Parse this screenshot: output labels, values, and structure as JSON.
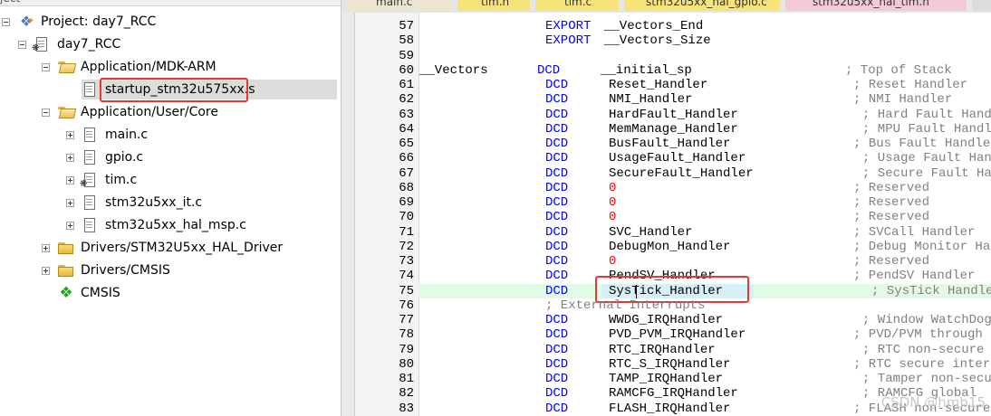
{
  "tree": {
    "top_caption": "ject",
    "project_label": "Project: day7_RCC",
    "target_label": "day7_RCC",
    "groups": [
      {
        "label": "Application/MDK-ARM",
        "children": [
          "startup_stm32u575xx.s"
        ]
      },
      {
        "label": "Application/User/Core",
        "children": [
          "main.c",
          "gpio.c",
          "tim.c",
          "stm32u5xx_it.c",
          "stm32u5xx_hal_msp.c"
        ]
      },
      {
        "label": "Drivers/STM32U5xx_HAL_Driver",
        "children": []
      },
      {
        "label": "Drivers/CMSIS",
        "children": []
      }
    ],
    "cmsis_label": "CMSIS"
  },
  "tabs": [
    "main.c",
    "tim.h",
    "tim.c",
    "stm32u5xx_hal_gpio.c",
    "stm32u5xx_hal_tim.h"
  ],
  "code_lines": [
    {
      "n": "57",
      "kw": "EXPORT",
      "name": "__Vectors_End",
      "cm": ""
    },
    {
      "n": "58",
      "kw": "EXPORT",
      "name": "__Vectors_Size",
      "cm": ""
    },
    {
      "n": "59",
      "kw": "",
      "name": "",
      "cm": ""
    },
    {
      "n": "60",
      "label": "__Vectors",
      "kw": "DCD",
      "name": "__initial_sp",
      "cm": "; Top of Stack"
    },
    {
      "n": "61",
      "kw": "DCD",
      "name": "Reset_Handler",
      "cm": "; Reset Handler"
    },
    {
      "n": "62",
      "kw": "DCD",
      "name": "NMI_Handler",
      "cm": "; NMI Handler"
    },
    {
      "n": "63",
      "kw": "DCD",
      "name": "HardFault_Handler",
      "cm": "; Hard Fault Handler"
    },
    {
      "n": "64",
      "kw": "DCD",
      "name": "MemManage_Handler",
      "cm": "; MPU Fault Handler"
    },
    {
      "n": "65",
      "kw": "DCD",
      "name": "BusFault_Handler",
      "cm": "; Bus Fault Handler"
    },
    {
      "n": "66",
      "kw": "DCD",
      "name": "UsageFault_Handler",
      "cm": "; Usage Fault Handler"
    },
    {
      "n": "67",
      "kw": "DCD",
      "name": "SecureFault_Handler",
      "cm": "; Secure Fault Handler"
    },
    {
      "n": "68",
      "kw": "DCD",
      "num": "0",
      "cm": "; Reserved"
    },
    {
      "n": "69",
      "kw": "DCD",
      "num": "0",
      "cm": "; Reserved"
    },
    {
      "n": "70",
      "kw": "DCD",
      "num": "0",
      "cm": "; Reserved"
    },
    {
      "n": "71",
      "kw": "DCD",
      "name": "SVC_Handler",
      "cm": "; SVCall Handler"
    },
    {
      "n": "72",
      "kw": "DCD",
      "name": "DebugMon_Handler",
      "cm": "; Debug Monitor Handler"
    },
    {
      "n": "73",
      "kw": "DCD",
      "num": "0",
      "cm": "; Reserved"
    },
    {
      "n": "74",
      "kw": "DCD",
      "name": "PendSV_Handler",
      "cm": "; PendSV Handler"
    },
    {
      "n": "75",
      "kw": "DCD",
      "name": "SysTick_Handler",
      "cm": "; SysTick Handler"
    },
    {
      "n": "76",
      "kw": "",
      "name": "",
      "cm": "; External Interrupts"
    },
    {
      "n": "77",
      "kw": "DCD",
      "name": "WWDG_IRQHandler",
      "cm": "; Window WatchDog"
    },
    {
      "n": "78",
      "kw": "DCD",
      "name": "PVD_PVM_IRQHandler",
      "cm": "; PVD/PVM through EXTI"
    },
    {
      "n": "79",
      "kw": "DCD",
      "name": "RTC_IRQHandler",
      "cm": "; RTC non-secure interrupt"
    },
    {
      "n": "80",
      "kw": "DCD",
      "name": "RTC_S_IRQHandler",
      "cm": "; RTC secure interrupt"
    },
    {
      "n": "81",
      "kw": "DCD",
      "name": "TAMP_IRQHandler",
      "cm": "; Tamper non-secure"
    },
    {
      "n": "82",
      "kw": "DCD",
      "name": "RAMCFG_IRQHandler",
      "cm": "; RAMCFG global"
    },
    {
      "n": "83",
      "kw": "DCD",
      "name": "FLASH_IRQHandler",
      "cm": "; FLASH non-secure"
    }
  ],
  "watermark": "CSDN @hmh15",
  "colors": {
    "keyword": "#0000ff",
    "number": "#ff0000",
    "comment": "#808080",
    "highlight_box": "#e53935",
    "current_line": "#e3fbe6"
  }
}
